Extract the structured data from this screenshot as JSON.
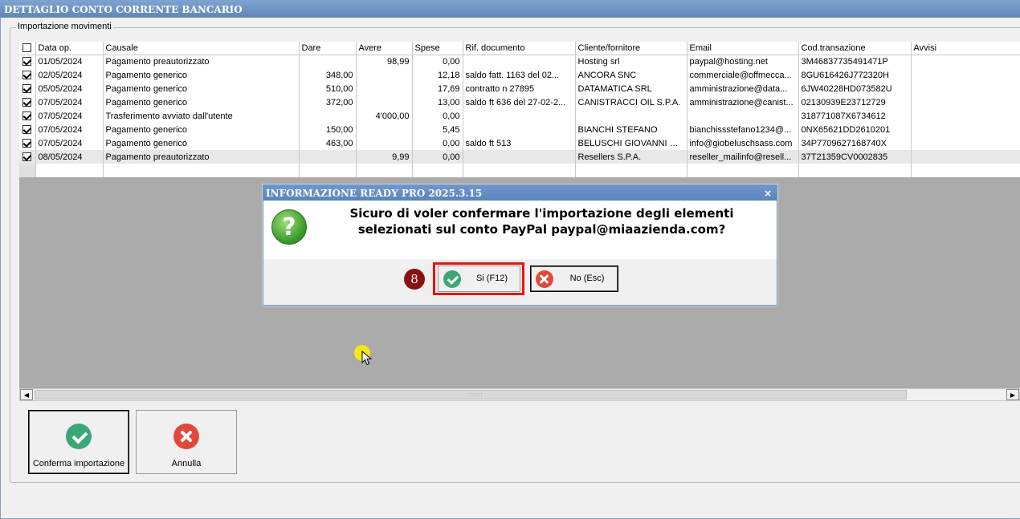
{
  "window": {
    "title": "DETTAGLIO CONTO CORRENTE BANCARIO"
  },
  "group": {
    "label": "Importazione movimenti"
  },
  "grid": {
    "columns": [
      "",
      "Data op.",
      "Causale",
      "Dare",
      "Avere",
      "Spese",
      "Rif. documento",
      "Cliente/fornitore",
      "Email",
      "Cod.transazione",
      "Avvisi"
    ],
    "rows": [
      {
        "checked": true,
        "data": "01/05/2024",
        "causale": "Pagamento preautorizzato",
        "dare": "",
        "avere": "98,99",
        "spese": "0,00",
        "rif": "",
        "cliente": "Hosting srl",
        "email": "paypal@hosting.net",
        "cod": "3M46837735491471P",
        "avvisi": ""
      },
      {
        "checked": true,
        "data": "02/05/2024",
        "causale": "Pagamento generico",
        "dare": "348,00",
        "avere": "",
        "spese": "12,18",
        "rif": "saldo fatt.  1163 del 02...",
        "cliente": "ANCORA SNC",
        "email": "commerciale@offmecca...",
        "cod": "8GU616426J772320H",
        "avvisi": ""
      },
      {
        "checked": true,
        "data": "05/05/2024",
        "causale": "Pagamento generico",
        "dare": "510,00",
        "avere": "",
        "spese": "17,69",
        "rif": "contratto n 27895",
        "cliente": "DATAMATICA SRL",
        "email": "amministrazione@data...",
        "cod": "6JW40228HD073582U",
        "avvisi": ""
      },
      {
        "checked": true,
        "data": "07/05/2024",
        "causale": "Pagamento generico",
        "dare": "372,00",
        "avere": "",
        "spese": "13,00",
        "rif": "saldo ft 636 del 27-02-2...",
        "cliente": "CANISTRACCI OIL S.P.A.",
        "email": "amministrazione@canist...",
        "cod": "02130939E23712729",
        "avvisi": ""
      },
      {
        "checked": true,
        "data": "07/05/2024",
        "causale": "Trasferimento avviato dall'utente",
        "dare": "",
        "avere": "4'000,00",
        "spese": "0,00",
        "rif": "",
        "cliente": "",
        "email": "",
        "cod": "318771087X6734612",
        "avvisi": ""
      },
      {
        "checked": true,
        "data": "07/05/2024",
        "causale": "Pagamento generico",
        "dare": "150,00",
        "avere": "",
        "spese": "5,45",
        "rif": "",
        "cliente": "BIANCHI STEFANO",
        "email": "bianchissstefano1234@...",
        "cod": "0NX65621DD2610201",
        "avvisi": ""
      },
      {
        "checked": true,
        "data": "07/05/2024",
        "causale": "Pagamento generico",
        "dare": "463,00",
        "avere": "",
        "spese": "0,00",
        "rif": "saldo ft 513",
        "cliente": "BELUSCHI GIOVANNI SAS",
        "email": "info@giobeluschsass.com",
        "cod": "34P7709627168740X",
        "avvisi": ""
      },
      {
        "checked": true,
        "data": "08/05/2024",
        "causale": "Pagamento preautorizzato",
        "dare": "",
        "avere": "9,99",
        "spese": "0,00",
        "rif": "",
        "cliente": "Resellers S.P.A.",
        "email": "reseller_mailinfo@resell...",
        "cod": "37T21359CV0002835",
        "avvisi": ""
      }
    ]
  },
  "buttons": {
    "confirm_label": "Conferma importazione",
    "cancel_label": "Annulla"
  },
  "dialog": {
    "title": "INFORMAZIONE READY PRO 2025.3.15",
    "close_glyph": "×",
    "icon_glyph": "?",
    "message": "Sicuro di voler confermare l'importazione degli elementi selezionati sul conto PayPal paypal@miaazienda.com?",
    "yes_label": "Si (F12)",
    "no_label": "No (Esc)",
    "step_badge": "8"
  },
  "scrollbar": {
    "left_arrow": "◀",
    "right_arrow": "▶",
    "grip": "::::::"
  },
  "colors": {
    "title_bar": "#6f97cc",
    "grid_background": "#ababab",
    "ok_green": "#3aa876",
    "cancel_red": "#e0493a",
    "highlight_red": "#ee1111"
  }
}
